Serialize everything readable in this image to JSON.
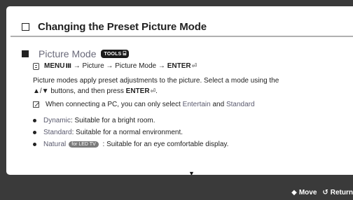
{
  "title": "Changing the Preset Picture Mode",
  "section": {
    "title": "Picture Mode",
    "tools_badge": "TOOLS",
    "tools_icon": "⌸"
  },
  "path": {
    "menu": "MENU",
    "menu_glyph": "Ⅲ",
    "arrow1": " → Picture → Picture Mode → ",
    "enter": "ENTER",
    "enter_glyph": "⏎"
  },
  "description": {
    "line1": "Picture modes apply preset adjustments to the picture. Select a mode using the",
    "line2_prefix": "▲/▼ buttons, and then press ",
    "enter": "ENTER",
    "enter_glyph": "⏎",
    "line2_suffix": "."
  },
  "note": {
    "prefix": "When connecting a PC, you can only select ",
    "opt1": "Entertain",
    "mid": " and ",
    "opt2": "Standard"
  },
  "bullets": [
    {
      "name": "Dynamic",
      "text": ": Suitable for a bright room."
    },
    {
      "name": "Standard",
      "text": ": Suitable for a normal environment."
    },
    {
      "name": "Natural",
      "badge": "for LED TV",
      "text": " : Suitable for an eye comfortable display."
    }
  ],
  "scroll_arrow": "▼",
  "footer": {
    "move_icon": "◆",
    "move_label": "Move",
    "return_icon": "↺",
    "return_label": "Return"
  }
}
